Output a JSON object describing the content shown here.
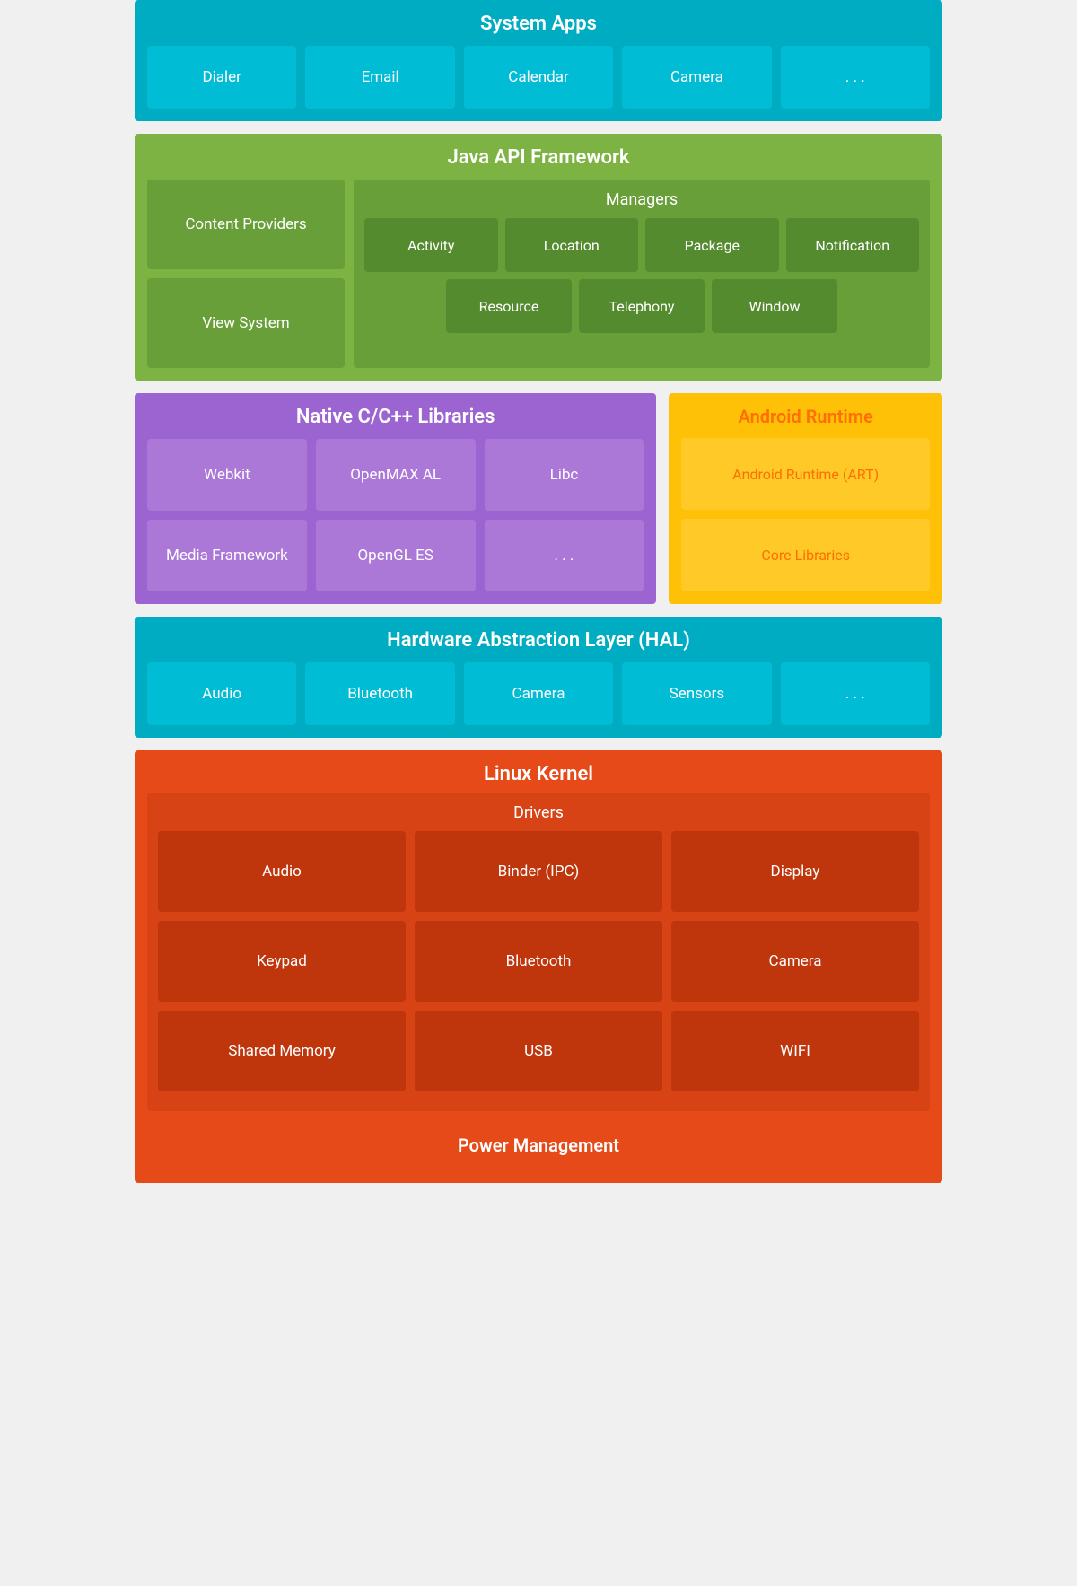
{
  "system_apps": {
    "title": "System Apps",
    "cards": [
      "Dialer",
      "Email",
      "Calendar",
      "Camera",
      ". . ."
    ]
  },
  "java_api": {
    "title": "Java API Framework",
    "left": [
      "Content Providers",
      "View System"
    ],
    "managers_title": "Managers",
    "managers_row1": [
      "Activity",
      "Location",
      "Package",
      "Notification"
    ],
    "managers_row2": [
      "Resource",
      "Telephony",
      "Window"
    ]
  },
  "native_libs": {
    "title": "Native C/C++ Libraries",
    "cards": [
      "Webkit",
      "OpenMAX AL",
      "Libc",
      "Media Framework",
      "OpenGL ES",
      ". . ."
    ]
  },
  "android_runtime": {
    "title": "Android Runtime",
    "cards": [
      "Android Runtime (ART)",
      "Core Libraries"
    ]
  },
  "hal": {
    "title": "Hardware Abstraction Layer (HAL)",
    "cards": [
      "Audio",
      "Bluetooth",
      "Camera",
      "Sensors",
      ". . ."
    ]
  },
  "linux_kernel": {
    "title": "Linux Kernel",
    "drivers_title": "Drivers",
    "drivers": [
      "Audio",
      "Binder (IPC)",
      "Display",
      "Keypad",
      "Bluetooth",
      "Camera",
      "Shared Memory",
      "USB",
      "WIFI"
    ],
    "power_mgmt": "Power Management"
  }
}
